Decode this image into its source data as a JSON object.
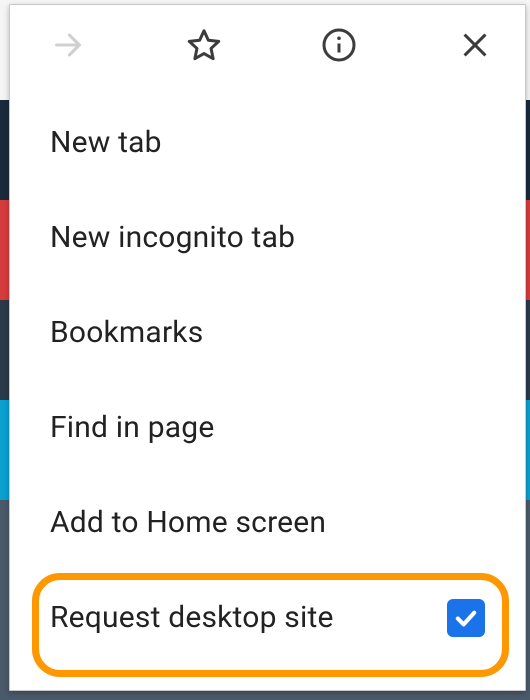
{
  "toolbar": {
    "forward": "forward",
    "bookmark": "bookmark",
    "info": "info",
    "close": "close"
  },
  "menu": {
    "items": [
      {
        "label": "New tab"
      },
      {
        "label": "New incognito tab"
      },
      {
        "label": "Bookmarks"
      },
      {
        "label": "Find in page"
      },
      {
        "label": "Add to Home screen"
      },
      {
        "label": "Request desktop site"
      }
    ],
    "request_desktop_checked": true
  },
  "colors": {
    "highlight": "#ff9800",
    "checkbox": "#1a73e8"
  }
}
